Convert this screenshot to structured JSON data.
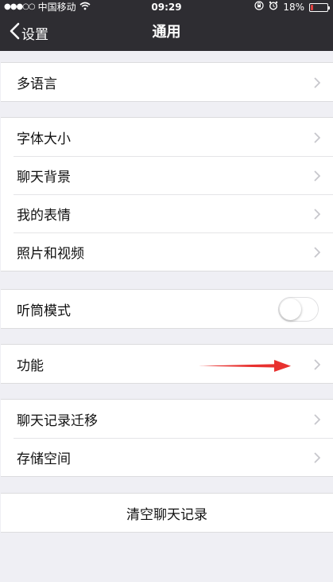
{
  "status_bar": {
    "signal": "●●●○○",
    "carrier": "中国移动",
    "time": "09:29",
    "battery": "18%",
    "battery_level": 0.18,
    "battery_color": "#e04040"
  },
  "nav": {
    "back_label": "设置",
    "title": "通用"
  },
  "groups": {
    "language": {
      "label": "多语言"
    },
    "display": [
      {
        "label": "字体大小"
      },
      {
        "label": "聊天背景"
      },
      {
        "label": "我的表情"
      },
      {
        "label": "照片和视频"
      }
    ],
    "earpiece": {
      "label": "听筒模式",
      "toggle_on": false
    },
    "features": {
      "label": "功能"
    },
    "storage": [
      {
        "label": "聊天记录迁移"
      },
      {
        "label": "存储空间"
      }
    ],
    "clear": {
      "label": "清空聊天记录"
    }
  },
  "icons": {
    "back": "chevron-left-icon",
    "disclosure": "chevron-right-icon",
    "wifi": "wifi-icon",
    "orientation_lock": "orientation-lock-icon",
    "alarm": "alarm-icon",
    "battery": "battery-icon",
    "annotation": "red-arrow-icon"
  },
  "colors": {
    "header_bg": "#2e2d32",
    "page_bg": "#efeff4",
    "annotation_arrow": "#e8312f"
  }
}
